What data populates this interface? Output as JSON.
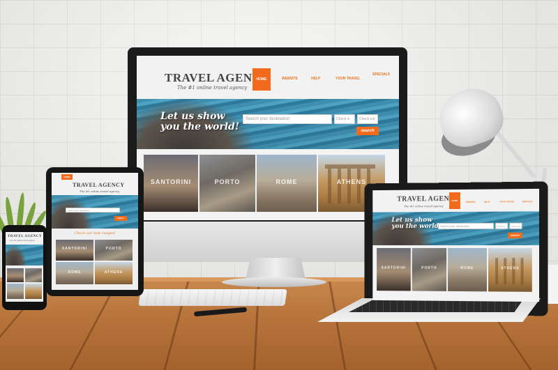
{
  "site": {
    "logo_title": "TRAVEL AGENCY",
    "logo_tagline": "The #1 online travel agency",
    "nav": [
      "HOME",
      "WEBSITE",
      "HELP",
      "YOUR TRAVEL",
      "SPECIALS"
    ],
    "hero_line1": "Let us show",
    "hero_line2": "you the world!",
    "search_placeholder": "Search your destination",
    "date_from": "Check in",
    "date_to": "Check out",
    "search_button": "search",
    "cities": [
      "SANTORINI",
      "PORTO",
      "ROME",
      "ATHENS"
    ],
    "tablet_strip": "Check our new ranges!"
  },
  "colors": {
    "accent": "#f26a1b",
    "sea": "#3f8fb1",
    "wood": "#b8753c",
    "wall": "#eeeeec"
  },
  "icons": [
    "desk-lamp-icon",
    "plant-icon",
    "pen-icon"
  ]
}
